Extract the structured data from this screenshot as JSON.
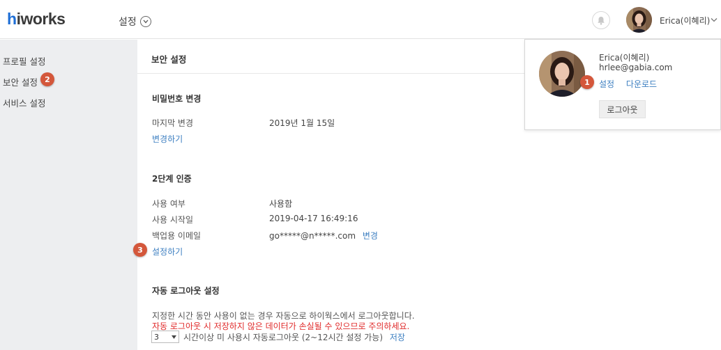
{
  "header": {
    "logo_h": "h",
    "logo_rest": "iworks",
    "menu_title": "설정",
    "user_name": "Erica(이혜리)"
  },
  "sidebar": {
    "items": [
      {
        "label": "프로필 설정"
      },
      {
        "label": "보안 설정"
      },
      {
        "label": "서비스 설정"
      }
    ]
  },
  "main": {
    "page_title": "보안 설정",
    "password": {
      "title": "비밀번호 변경",
      "last_changed_label": "마지막 변경",
      "last_changed_value": "2019년 1월 15일",
      "change_link": "변경하기"
    },
    "two_factor": {
      "title": "2단계 인증",
      "usage_label": "사용 여부",
      "usage_value": "사용함",
      "start_label": "사용 시작일",
      "start_value": "2019-04-17 16:49:16",
      "backup_label": "백업용 이메일",
      "backup_value": "go*****@n*****.com",
      "backup_change": "변경",
      "setup_link": "설정하기"
    },
    "auto_logout": {
      "title": "자동 로그아웃 설정",
      "desc": "지정한 시간 동안 사용이 없는 경우 자동으로 하이웍스에서 로그아웃합니다.",
      "warning": "자동 로그아웃 시 저장하지 않은 데이터가 손실될 수 있으므로 주의하세요.",
      "hours_value": "3",
      "hours_desc": "시간이상 미 사용시 자동로그아웃 (2~12시간 설정 가능)",
      "save_link": "저장"
    }
  },
  "dropdown": {
    "name": "Erica(이혜리)",
    "email": "hrlee@gabia.com",
    "settings_link": "설정",
    "download_link": "다운로드",
    "logout_button": "로그아웃"
  },
  "badges": {
    "b1": "1",
    "b2": "2",
    "b3": "3"
  },
  "colors": {
    "accent_link": "#3d7fc1",
    "badge": "#d4573b",
    "warning": "#e02b2b",
    "logo_blue": "#1f6fd6",
    "sidebar_bg": "#edeef0"
  },
  "icons": {
    "menu_chevron": "chevron-down-circle-icon",
    "bell": "bell-icon",
    "user_chevron": "chevron-down-icon",
    "select_arrow": "caret-down-icon"
  }
}
